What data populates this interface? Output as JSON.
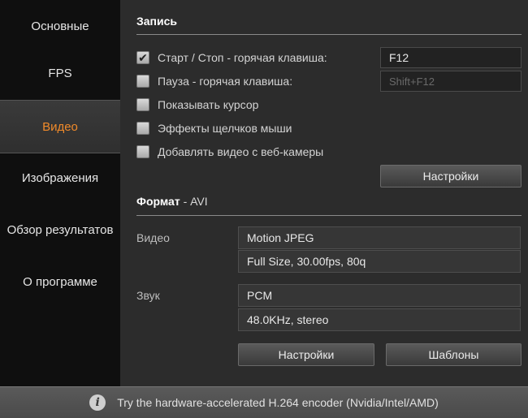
{
  "sidebar": {
    "items": [
      {
        "label": "Основные"
      },
      {
        "label": "FPS"
      },
      {
        "label": "Видео"
      },
      {
        "label": "Изображения"
      },
      {
        "label": "Обзор результатов"
      },
      {
        "label": "О программе"
      }
    ],
    "active_index": 2
  },
  "record": {
    "title": "Запись",
    "checkboxes": [
      {
        "label": "Старт / Стоп - горячая клавиша:",
        "checked": true
      },
      {
        "label": "Пауза - горячая клавиша:",
        "checked": false
      },
      {
        "label": "Показывать курсор",
        "checked": false
      },
      {
        "label": "Эффекты щелчков мыши",
        "checked": false
      },
      {
        "label": "Добавлять видео с веб-камеры",
        "checked": false
      }
    ],
    "start_stop_hotkey": "F12",
    "pause_hotkey": "Shift+F12",
    "settings_button": "Настройки"
  },
  "format": {
    "title": "Формат",
    "subtitle": " - AVI",
    "video_label": "Видео",
    "video_codec": "Motion JPEG",
    "video_params": "Full Size, 30.00fps, 80q",
    "audio_label": "Звук",
    "audio_codec": "PCM",
    "audio_params": "48.0KHz, stereo",
    "settings_button": "Настройки",
    "templates_button": "Шаблоны"
  },
  "footer": {
    "icon": "info-icon",
    "message": "Try the hardware-accelerated H.264 encoder (Nvidia/Intel/AMD)"
  },
  "colors": {
    "accent": "#f08a2a"
  }
}
